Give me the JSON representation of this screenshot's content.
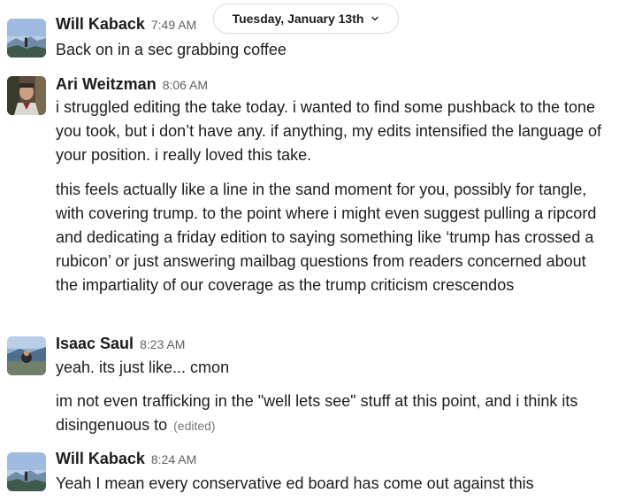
{
  "date_divider": {
    "label": "Tuesday, January 13th",
    "icon": "chevron-down-icon"
  },
  "messages": [
    {
      "author": "Will Kaback",
      "time": "7:49 AM",
      "avatar": "mountain-photo-avatar",
      "paragraphs": [
        "Back on in a sec grabbing coffee"
      ]
    },
    {
      "author": "Ari Weitzman",
      "time": "8:06 AM",
      "avatar": "person-photo-avatar",
      "paragraphs": [
        "i struggled editing the take today. i wanted to find some pushback to the tone you took, but i don’t have any. if anything, my edits intensified the language of your position. i really loved this take.",
        "this feels actually like a line in the sand moment for you, possibly for tangle, with covering trump. to the point where i might even suggest pulling a ripcord and dedicating a friday edition to saying something like ‘trump has crossed a rubicon’ or just answering mailbag questions from readers concerned about the impartiality of our coverage as the trump criticism crescendos"
      ]
    },
    {
      "author": "Isaac Saul",
      "time": "8:23 AM",
      "avatar": "lake-photo-avatar",
      "paragraphs": [
        "yeah. its just like... cmon",
        "im not even trafficking in the \"well lets see\" stuff at this point, and i think its disingenuous to"
      ],
      "edited_label": "(edited)"
    },
    {
      "author": "Will Kaback",
      "time": "8:24 AM",
      "avatar": "mountain-photo-avatar",
      "paragraphs": [
        "Yeah I mean every conservative ed board has come out against this"
      ]
    }
  ]
}
